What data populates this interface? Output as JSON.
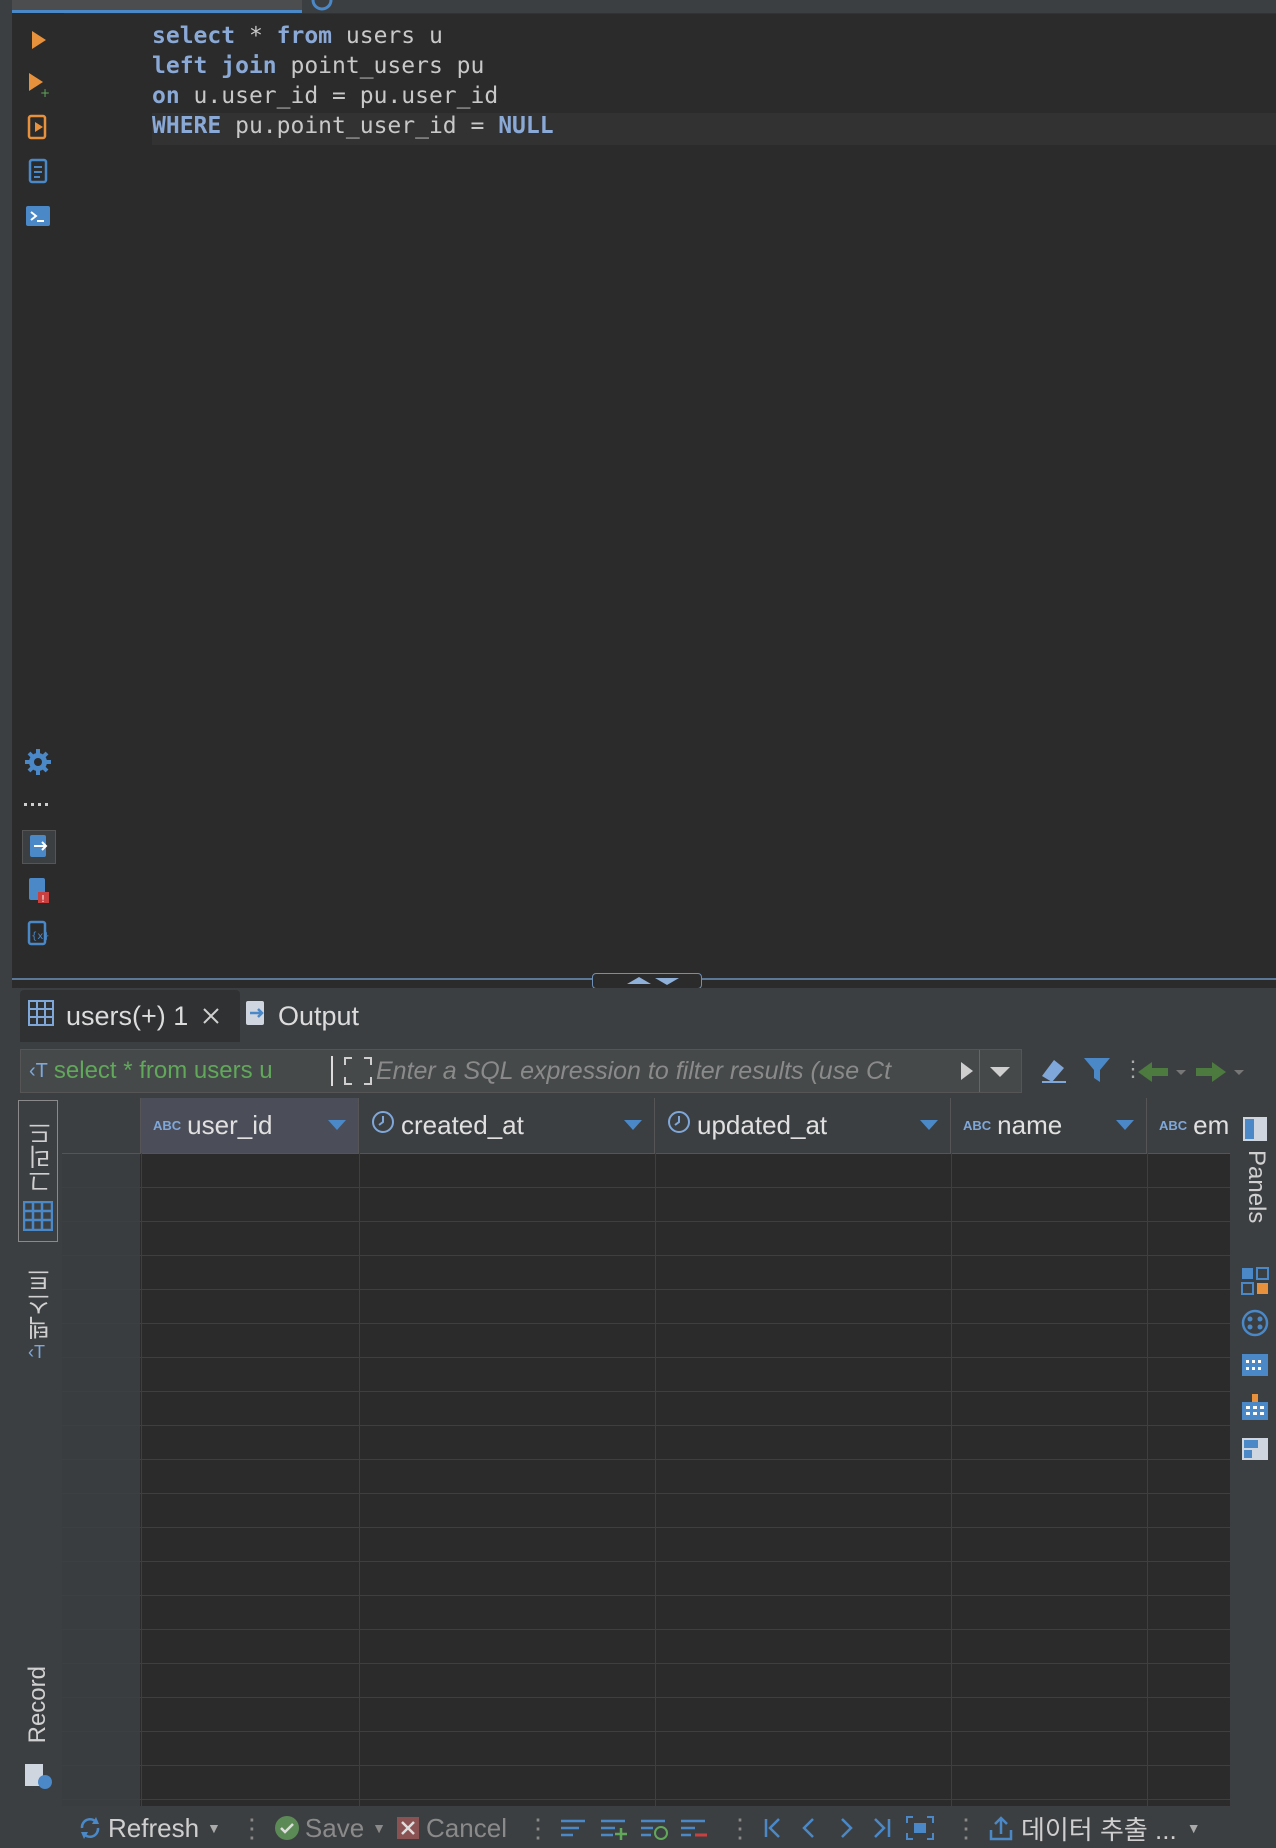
{
  "editor": {
    "lines": [
      {
        "kw1": "select",
        "rest1": " * ",
        "kw2": "from",
        "rest2": " users u"
      },
      {
        "kw1": "left join",
        "rest1": " point_users pu",
        "kw2": "",
        "rest2": ""
      },
      {
        "kw1": "on",
        "rest1": " u.user_id = pu.user_id",
        "kw2": "",
        "rest2": ""
      },
      {
        "kw1": "WHERE",
        "rest1": " pu.point_user_id = ",
        "kw2": "NULL",
        "rest2": ""
      }
    ]
  },
  "results": {
    "tabs": [
      {
        "label": "users(+) 1"
      },
      {
        "label": "Output"
      }
    ],
    "filter_query": "select * from users u",
    "filter_placeholder": "Enter a SQL expression to filter results (use Ct",
    "columns": [
      {
        "type": "ABC",
        "name": "user_id"
      },
      {
        "type": "clock",
        "name": "created_at"
      },
      {
        "type": "clock",
        "name": "updated_at"
      },
      {
        "type": "ABC",
        "name": "name"
      },
      {
        "type": "ABC",
        "name": "em"
      }
    ],
    "side_tabs": {
      "grid": "그리드",
      "text": "텍스트",
      "record": "Record"
    },
    "panels_label": "Panels"
  },
  "toolbar": {
    "refresh": "Refresh",
    "save": "Save",
    "cancel": "Cancel",
    "export": "데이터 추출 ..."
  },
  "colors": {
    "accent": "#4a88c7",
    "keyword": "#8aa9d6",
    "run": "#e8913c",
    "green": "#61a85a"
  }
}
